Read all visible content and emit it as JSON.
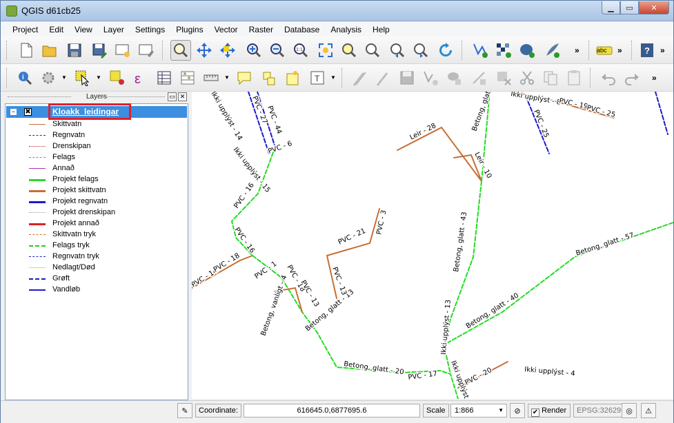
{
  "window": {
    "title": "QGIS d61cb25"
  },
  "menu": [
    "Project",
    "Edit",
    "View",
    "Layer",
    "Settings",
    "Plugins",
    "Vector",
    "Raster",
    "Database",
    "Analysis",
    "Help"
  ],
  "toolbar1": {
    "buttons": [
      {
        "icon": "new-project-icon"
      },
      {
        "icon": "open-project-icon"
      },
      {
        "icon": "save-project-icon"
      },
      {
        "icon": "save-as-icon"
      },
      {
        "icon": "new-print-composer-icon"
      },
      {
        "icon": "composer-manager-icon"
      },
      {
        "icon": "pan-map-icon"
      },
      {
        "icon": "pan-to-selection-icon"
      },
      {
        "icon": "move-feature-icon"
      },
      {
        "icon": "zoom-in-icon"
      },
      {
        "icon": "zoom-out-icon"
      },
      {
        "icon": "zoom-actual-size-icon"
      },
      {
        "icon": "zoom-full-icon"
      },
      {
        "icon": "zoom-to-selection-icon"
      },
      {
        "icon": "zoom-to-layer-icon"
      },
      {
        "icon": "zoom-last-icon"
      },
      {
        "icon": "zoom-next-icon"
      },
      {
        "icon": "refresh-icon"
      },
      {
        "icon": "add-vector-layer-icon"
      },
      {
        "icon": "add-raster-layer-icon"
      },
      {
        "icon": "add-postgis-layer-icon"
      },
      {
        "icon": "add-spatialite-layer-icon"
      },
      {
        "icon": "label-icon"
      },
      {
        "icon": "help-icon"
      }
    ],
    "label_badge": "abc",
    "more": "»"
  },
  "toolbar2": {
    "buttons": [
      {
        "icon": "identify-icon"
      },
      {
        "icon": "run-action-icon"
      },
      {
        "icon": "select-features-icon"
      },
      {
        "icon": "deselect-icon"
      },
      {
        "icon": "field-calculator-icon"
      },
      {
        "icon": "attribute-table-icon"
      },
      {
        "icon": "statistics-icon"
      },
      {
        "icon": "measure-icon"
      },
      {
        "icon": "map-tips-icon"
      },
      {
        "icon": "new-bookmark-icon"
      },
      {
        "icon": "annotation-icon"
      },
      {
        "icon": "text-annotation-icon"
      },
      {
        "icon": "toggle-editing-icon"
      },
      {
        "icon": "current-edits-icon"
      },
      {
        "icon": "save-edits-icon"
      },
      {
        "icon": "add-feature-icon"
      },
      {
        "icon": "move-feature-tool-icon"
      },
      {
        "icon": "node-tool-icon"
      },
      {
        "icon": "delete-selected-icon"
      },
      {
        "icon": "cut-features-icon"
      },
      {
        "icon": "copy-features-icon"
      },
      {
        "icon": "paste-features-icon"
      },
      {
        "icon": "undo-icon"
      },
      {
        "icon": "redo-icon"
      }
    ],
    "more": "»"
  },
  "layers_panel": {
    "title": "Layers",
    "layer": {
      "name": "Kloakk_leidingar",
      "visible_mark": "✖",
      "collapse_mark": "−"
    },
    "legend": [
      {
        "label": "Skittvatn",
        "color": "#c86e32",
        "style": "solid",
        "width": 1
      },
      {
        "label": "Regnvatn",
        "color": "#2222cc",
        "style": "dashed",
        "width": 1
      },
      {
        "label": "Drenskipan",
        "color": "#cc2222",
        "style": "dotted",
        "width": 1
      },
      {
        "label": "Felags",
        "color": "#22cc22",
        "style": "dashed",
        "width": 1
      },
      {
        "label": "Annað",
        "color": "#b030b0",
        "style": "solid",
        "width": 1
      },
      {
        "label": "Projekt felags",
        "color": "#22dd22",
        "style": "solid",
        "width": 3
      },
      {
        "label": "Projekt skittvatn",
        "color": "#c86e32",
        "style": "solid",
        "width": 3
      },
      {
        "label": "Projekt regnvatn",
        "color": "#1a1acc",
        "style": "solid",
        "width": 3
      },
      {
        "label": "Projekt drenskipan",
        "color": "#999999",
        "style": "dotted",
        "width": 1
      },
      {
        "label": "Projekt annað",
        "color": "#dd2222",
        "style": "solid",
        "width": 3
      },
      {
        "label": "Skittvatn tryk",
        "color": "#c86e32",
        "style": "dashed",
        "width": 1
      },
      {
        "label": "Felags tryk",
        "color": "#22cc22",
        "style": "dashed",
        "width": 2
      },
      {
        "label": "Regnvatn tryk",
        "color": "#2222cc",
        "style": "dashed",
        "width": 1
      },
      {
        "label": "Nedlagt/Død",
        "color": "#e8e020",
        "style": "solid",
        "width": 1
      },
      {
        "label": "Grøft",
        "color": "#1a1acc",
        "style": "dashed",
        "width": 2
      },
      {
        "label": "Vandløb",
        "color": "#1a1acc",
        "style": "solid",
        "width": 2
      }
    ]
  },
  "map": {
    "labels": [
      "Ikki upplýst - 14",
      "PVC - 27",
      "PVC - 44",
      "PVC - 6",
      "Ikki upplýst - 15",
      "PVC - 16",
      "PVC - 16",
      "PVC - 14",
      "PVC - 18",
      "PVC - 1",
      "PVC - 18",
      "PVC - 13",
      "Betong, vanligt - 4",
      "Betong, glatt - 13",
      "PVC - 21",
      "PVC - 3",
      "PVC - 13",
      "Leir - 28",
      "Leir - 10",
      "Betong, glatt - 43",
      "Betong, glatt",
      "Ikki upplýst - 8",
      "PVC - 19",
      "PVC - 25",
      "PVC - 25",
      "Betong, glatt - 57",
      "Betong, glatt - 40",
      "Ikki upplýst - 13",
      "Betong, glatt - 20",
      "PVC - 17",
      "Ikki upplýst",
      "PVC - 20",
      "Ikki upplýst - 4"
    ]
  },
  "statusbar": {
    "coordinate_label": "Coordinate:",
    "coordinate_value": "616645.0,6877695.6",
    "scale_label": "Scale",
    "scale_value": "1:866",
    "render_label": "Render",
    "crs": "EPSG:32629",
    "render_checked_mark": "✔"
  }
}
